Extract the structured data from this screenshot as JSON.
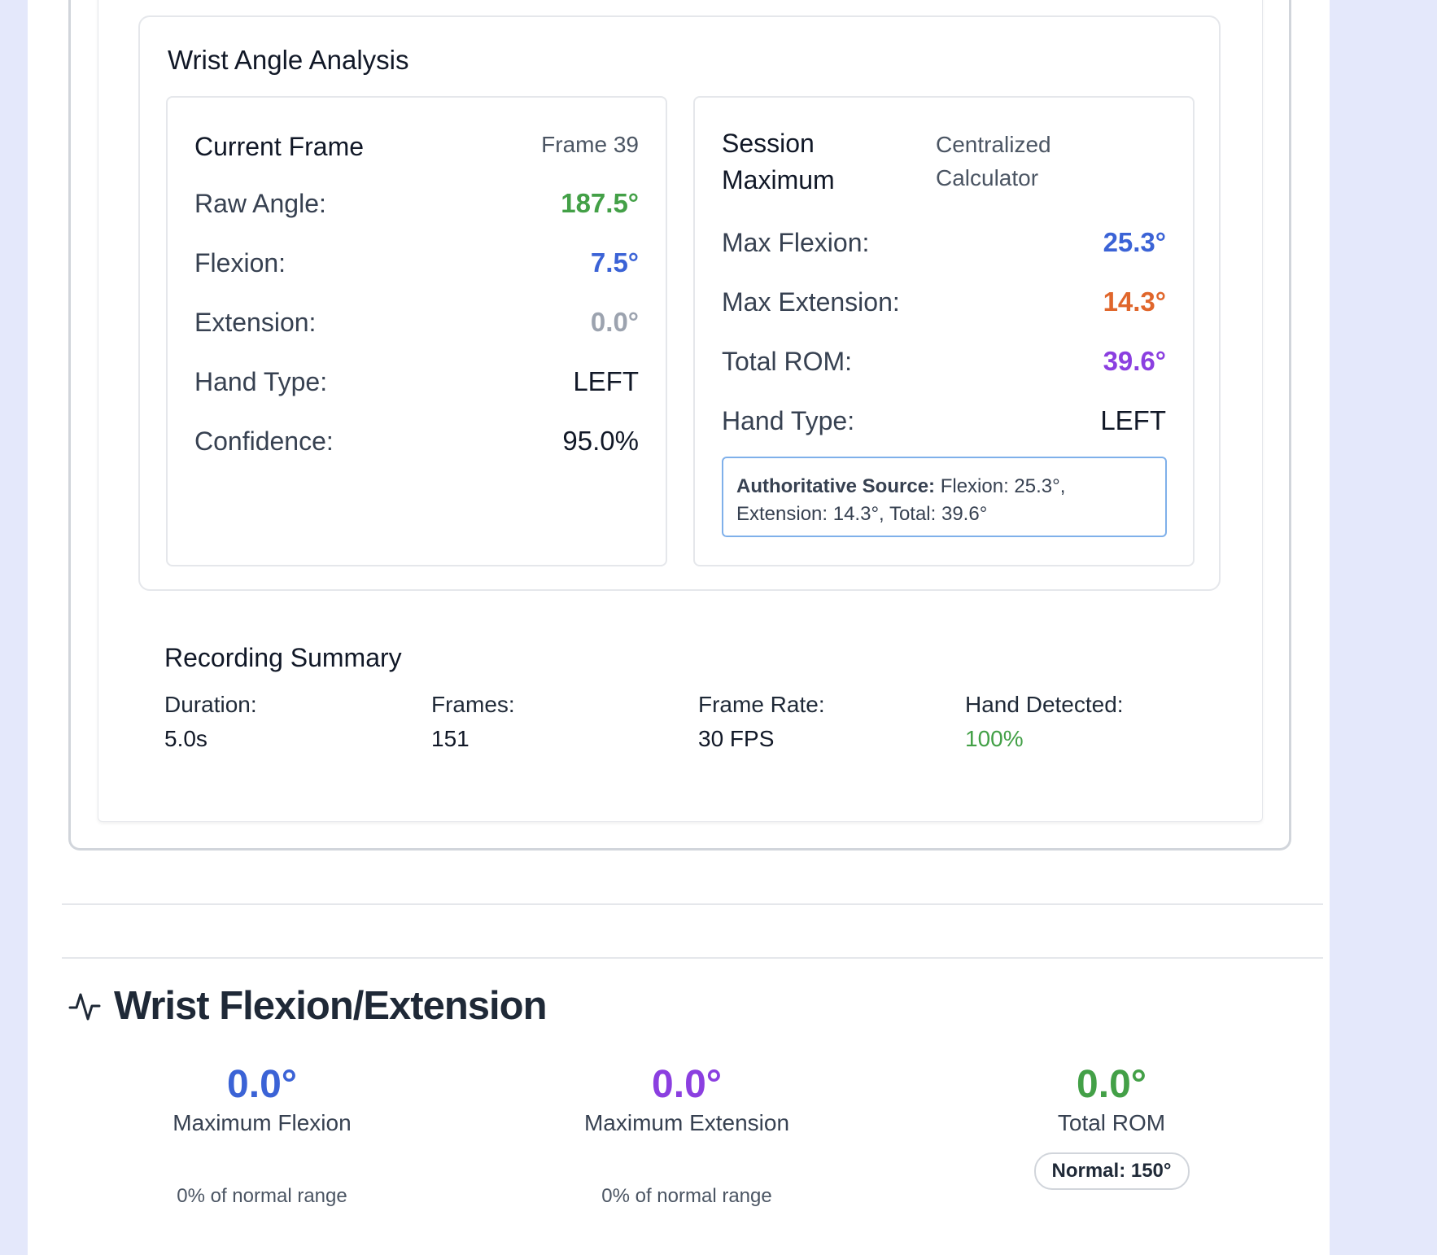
{
  "analysis": {
    "title": "Wrist Angle Analysis",
    "current_frame": {
      "title": "Current Frame",
      "frame_label": "Frame 39",
      "rows": [
        {
          "label": "Raw Angle:",
          "value": "187.5°"
        },
        {
          "label": "Flexion:",
          "value": "7.5°"
        },
        {
          "label": "Extension:",
          "value": "0.0°"
        },
        {
          "label": "Hand Type:",
          "value": "LEFT"
        },
        {
          "label": "Confidence:",
          "value": "95.0%"
        }
      ]
    },
    "session_max": {
      "title_line1": "Session",
      "title_line2": "Maximum",
      "note_line1": "Centralized",
      "note_line2": "Calculator",
      "rows": [
        {
          "label": "Max Flexion:",
          "value": "25.3°"
        },
        {
          "label": "Max Extension:",
          "value": "14.3°"
        },
        {
          "label": "Total ROM:",
          "value": "39.6°"
        },
        {
          "label": "Hand Type:",
          "value": "LEFT"
        }
      ],
      "auth_label": "Authoritative Source:",
      "auth_text_line1": " Flexion: 25.3°,",
      "auth_text_line2": "Extension: 14.3°, Total: 39.6°"
    }
  },
  "summary": {
    "title": "Recording Summary",
    "items": [
      {
        "label": "Duration:",
        "value": "5.0s"
      },
      {
        "label": "Frames:",
        "value": "151"
      },
      {
        "label": "Frame Rate:",
        "value": "30 FPS"
      },
      {
        "label": "Hand Detected:",
        "value": "100%"
      }
    ]
  },
  "flexion_extension": {
    "title": "Wrist Flexion/Extension",
    "metrics": [
      {
        "value": "0.0°",
        "caption": "Maximum Flexion",
        "note": "0% of normal range",
        "color": "#3b63d6"
      },
      {
        "value": "0.0°",
        "caption": "Maximum Extension",
        "note": "0% of normal range",
        "color": "#8b3fe0"
      },
      {
        "value": "0.0°",
        "caption": "Total ROM",
        "badge": "Normal: 150°",
        "color": "#43a047"
      }
    ]
  },
  "icons": {
    "section_icon": "activity-icon"
  }
}
